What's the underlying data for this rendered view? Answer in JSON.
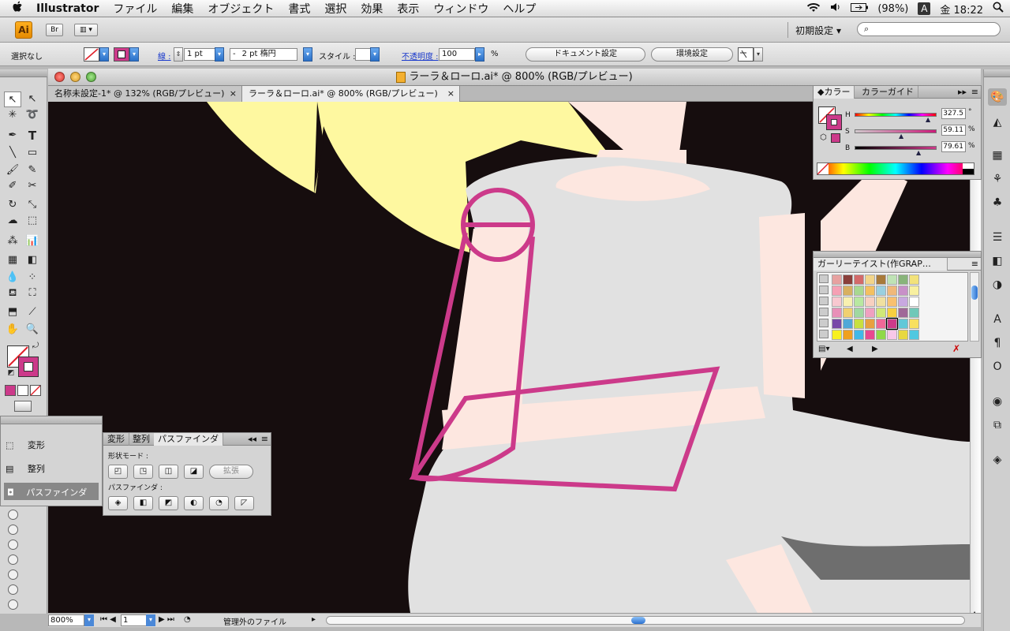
{
  "menubar": {
    "apple": "",
    "app_name": "Illustrator",
    "menus": [
      "ファイル",
      "編集",
      "オブジェクト",
      "書式",
      "選択",
      "効果",
      "表示",
      "ウィンドウ",
      "ヘルプ"
    ],
    "battery": "(98%)",
    "input": "A",
    "clock": "金 18:22"
  },
  "appbar": {
    "ai_logo": "Ai",
    "bridge": "Br",
    "workspace": "初期設定 ▾",
    "search_placeholder": ""
  },
  "controlbar": {
    "selection": "選択なし",
    "stroke_label": "線 :",
    "stroke_weight": "1 pt",
    "brush": "2 pt 楕円",
    "style_label": "スタイル :",
    "opacity_label": "不透明度 :",
    "opacity": "100",
    "percent": "%",
    "doc_settings": "ドキュメント設定",
    "prefs": "環境設定"
  },
  "document": {
    "title": "ラーラ＆ローロ.ai* @ 800% (RGB/プレビュー)",
    "tabs": [
      {
        "label": "名称未設定-1* @ 132% (RGB/プレビュー)",
        "close": "×"
      },
      {
        "label": "ラーラ＆ローロ.ai* @ 800% (RGB/プレビュー)",
        "close": "×"
      }
    ],
    "zoom": "800%",
    "artboard": "1",
    "status": "管理外のファイル"
  },
  "color_panel": {
    "tabs": [
      "カラー",
      "カラーガイド"
    ],
    "channels": [
      {
        "label": "H",
        "value": "327.5",
        "unit": "°"
      },
      {
        "label": "S",
        "value": "59.11",
        "unit": "%"
      },
      {
        "label": "B",
        "value": "79.61",
        "unit": "%"
      }
    ],
    "accent": "#cc3a8a"
  },
  "swatch_panel": {
    "title": "ガーリーテイスト(作GRAP…",
    "rows": [
      [
        "#e7a1a0",
        "#8a3f3a",
        "#d46a6a",
        "#f2d58a",
        "#a87a3a",
        "#bfe3b5",
        "#88b47a",
        "#f2e27a"
      ],
      [
        "#f5a0b4",
        "#d8b060",
        "#a8d890",
        "#f4c060",
        "#9ad0e0",
        "#f0b87a",
        "#c890c8",
        "#f8f0a0"
      ],
      [
        "#f8c8d0",
        "#f8f0b0",
        "#b8e8a0",
        "#f8d0c0",
        "#f0e0a0",
        "#f8c070",
        "#c8a8e0",
        "#ffffff"
      ],
      [
        "#e890b8",
        "#f0d070",
        "#a0d8a0",
        "#f0a0c0",
        "#d0e878",
        "#f8d040",
        "#a06898",
        "#70c8b8"
      ],
      [
        "#7848a8",
        "#50a8d8",
        "#c8e040",
        "#e8a040",
        "#f06898",
        "#cc3a8a",
        "#60c8d8",
        "#f8e060"
      ],
      [
        "#f8f020",
        "#f0a020",
        "#40b8e8",
        "#e84890",
        "#90d848",
        "#f8c8e8",
        "#e8d840",
        "#50c8e0"
      ]
    ]
  },
  "transform_panel": {
    "items": [
      "変形",
      "整列",
      "パスファインダ"
    ]
  },
  "pathfinder_panel": {
    "tabs": [
      "変形",
      "整列",
      "パスファインダ"
    ],
    "shape_modes": "形状モード :",
    "pathfinders": "パスファインダ :",
    "expand": "拡張"
  }
}
